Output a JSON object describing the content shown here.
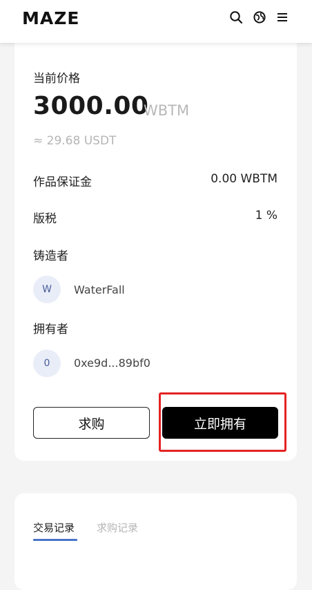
{
  "header": {
    "logo": "MAZE",
    "icons": [
      "search-icon",
      "globe-icon",
      "menu-icon"
    ]
  },
  "price": {
    "label": "当前价格",
    "value": "3000.00",
    "unit": "WBTM",
    "approx": "≈ 29.68 USDT"
  },
  "details": [
    {
      "label": "作品保证金",
      "value": "0.00 WBTM"
    },
    {
      "label": "版税",
      "value": "1 %"
    }
  ],
  "creator": {
    "label": "铸造者",
    "avatar_letter": "W",
    "name": "WaterFall"
  },
  "owner": {
    "label": "拥有者",
    "avatar_letter": "0",
    "address": "0xe9d...89bf0"
  },
  "actions": {
    "request_label": "求购",
    "buy_label": "立即拥有"
  },
  "tabs": [
    {
      "label": "交易记录",
      "active": true
    },
    {
      "label": "求购记录",
      "active": false
    }
  ],
  "colors": {
    "highlight": "#e52222",
    "tab_underline": "#4a73c8",
    "avatar_bg": "#e9edf8"
  }
}
